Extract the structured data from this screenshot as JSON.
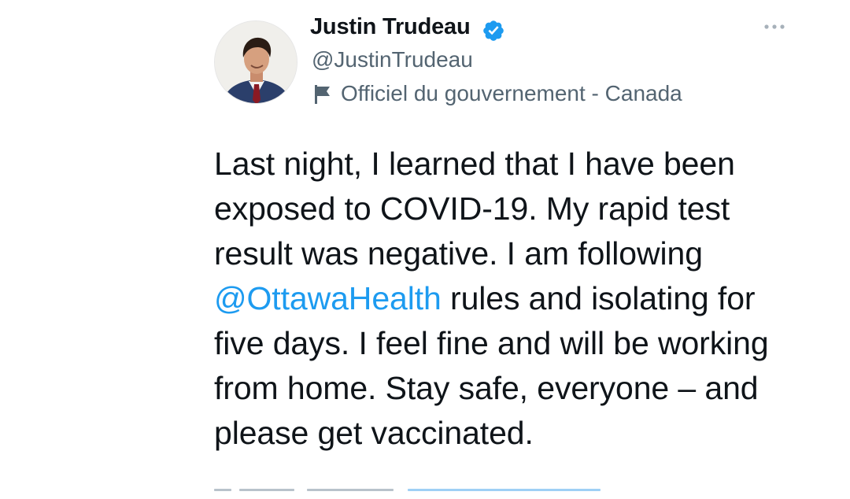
{
  "author": {
    "name": "Justin Trudeau",
    "handle": "@JustinTrudeau",
    "verified": true,
    "label": "Officiel du gouvernement - Canada",
    "avatar_icon": "profile-photo"
  },
  "tweet": {
    "text_before_mention": "Last night, I learned that I have been exposed to COVID-19. My rapid test result was negative. I am following ",
    "mention": "@OttawaHealth",
    "text_after_mention": " rules and isolating for five days. I feel fine and will be working from home. Stay safe, everyone – and please get vaccinated."
  },
  "icons": {
    "verified": "verified-badge-icon",
    "more": "more-options-icon",
    "label": "flag-icon"
  },
  "colors": {
    "accent": "#1d9bf0",
    "text": "#0f1419",
    "secondary_text": "#536471",
    "background": "#ffffff"
  }
}
